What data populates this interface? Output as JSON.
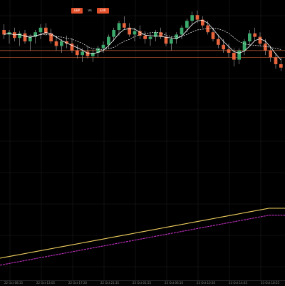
{
  "header": {
    "badge_left": "GBP",
    "badge_right": "EUR",
    "badge_separator": "vs"
  },
  "x_axis": {
    "ticks": [
      "22 Oct 08:15",
      "22 Oct 13:05",
      "22 Oct 17:20",
      "22 Oct 21:35",
      "23 Oct 01:55",
      "23 Oct 06:10",
      "23 Oct 10:30",
      "23 Oct 14:45",
      "23 Oct 18:55"
    ]
  },
  "colors": {
    "background": "#000000",
    "grid": "#1c1c1c",
    "bull": "#3aa96b",
    "bear": "#e8643c",
    "wick": "#9a9a9a",
    "ma_fast": "#ffffff",
    "ma_slow": "#ffffff",
    "level_line": "#b0552e",
    "lower_yellow": "#f0d060",
    "lower_magenta": "#c030c0"
  },
  "chart_data": [
    {
      "type": "candlestick",
      "title": "",
      "ylim": [
        0,
        100
      ],
      "candles": [
        {
          "o": 80,
          "h": 85,
          "l": 72,
          "c": 76
        },
        {
          "o": 76,
          "h": 80,
          "l": 68,
          "c": 78
        },
        {
          "o": 78,
          "h": 82,
          "l": 70,
          "c": 73
        },
        {
          "o": 73,
          "h": 79,
          "l": 66,
          "c": 77
        },
        {
          "o": 77,
          "h": 80,
          "l": 68,
          "c": 70
        },
        {
          "o": 70,
          "h": 76,
          "l": 62,
          "c": 74
        },
        {
          "o": 74,
          "h": 80,
          "l": 68,
          "c": 78
        },
        {
          "o": 78,
          "h": 85,
          "l": 72,
          "c": 82
        },
        {
          "o": 82,
          "h": 86,
          "l": 75,
          "c": 77
        },
        {
          "o": 77,
          "h": 81,
          "l": 68,
          "c": 70
        },
        {
          "o": 70,
          "h": 75,
          "l": 62,
          "c": 66
        },
        {
          "o": 66,
          "h": 72,
          "l": 60,
          "c": 70
        },
        {
          "o": 70,
          "h": 75,
          "l": 64,
          "c": 68
        },
        {
          "o": 68,
          "h": 73,
          "l": 60,
          "c": 62
        },
        {
          "o": 62,
          "h": 67,
          "l": 55,
          "c": 58
        },
        {
          "o": 58,
          "h": 64,
          "l": 52,
          "c": 61
        },
        {
          "o": 61,
          "h": 66,
          "l": 55,
          "c": 57
        },
        {
          "o": 57,
          "h": 63,
          "l": 52,
          "c": 60
        },
        {
          "o": 60,
          "h": 66,
          "l": 56,
          "c": 64
        },
        {
          "o": 64,
          "h": 70,
          "l": 60,
          "c": 67
        },
        {
          "o": 67,
          "h": 76,
          "l": 64,
          "c": 74
        },
        {
          "o": 74,
          "h": 82,
          "l": 70,
          "c": 80
        },
        {
          "o": 80,
          "h": 88,
          "l": 75,
          "c": 86
        },
        {
          "o": 86,
          "h": 92,
          "l": 80,
          "c": 82
        },
        {
          "o": 82,
          "h": 86,
          "l": 74,
          "c": 76
        },
        {
          "o": 76,
          "h": 82,
          "l": 70,
          "c": 79
        },
        {
          "o": 79,
          "h": 84,
          "l": 72,
          "c": 75
        },
        {
          "o": 75,
          "h": 79,
          "l": 68,
          "c": 72
        },
        {
          "o": 72,
          "h": 77,
          "l": 66,
          "c": 74
        },
        {
          "o": 74,
          "h": 80,
          "l": 70,
          "c": 78
        },
        {
          "o": 78,
          "h": 82,
          "l": 72,
          "c": 74
        },
        {
          "o": 74,
          "h": 78,
          "l": 66,
          "c": 68
        },
        {
          "o": 68,
          "h": 74,
          "l": 62,
          "c": 72
        },
        {
          "o": 72,
          "h": 78,
          "l": 68,
          "c": 76
        },
        {
          "o": 76,
          "h": 84,
          "l": 72,
          "c": 82
        },
        {
          "o": 82,
          "h": 90,
          "l": 78,
          "c": 88
        },
        {
          "o": 88,
          "h": 96,
          "l": 84,
          "c": 93
        },
        {
          "o": 93,
          "h": 97,
          "l": 86,
          "c": 89
        },
        {
          "o": 89,
          "h": 92,
          "l": 82,
          "c": 84
        },
        {
          "o": 84,
          "h": 88,
          "l": 76,
          "c": 78
        },
        {
          "o": 78,
          "h": 82,
          "l": 70,
          "c": 72
        },
        {
          "o": 72,
          "h": 76,
          "l": 64,
          "c": 67
        },
        {
          "o": 67,
          "h": 72,
          "l": 60,
          "c": 63
        },
        {
          "o": 63,
          "h": 68,
          "l": 56,
          "c": 60
        },
        {
          "o": 60,
          "h": 64,
          "l": 48,
          "c": 54
        },
        {
          "o": 54,
          "h": 64,
          "l": 50,
          "c": 62
        },
        {
          "o": 62,
          "h": 72,
          "l": 58,
          "c": 70
        },
        {
          "o": 70,
          "h": 80,
          "l": 66,
          "c": 77
        },
        {
          "o": 77,
          "h": 82,
          "l": 70,
          "c": 74
        },
        {
          "o": 74,
          "h": 78,
          "l": 66,
          "c": 68
        },
        {
          "o": 68,
          "h": 72,
          "l": 58,
          "c": 62
        },
        {
          "o": 62,
          "h": 66,
          "l": 52,
          "c": 56
        },
        {
          "o": 56,
          "h": 60,
          "l": 46,
          "c": 50
        },
        {
          "o": 50,
          "h": 56,
          "l": 44,
          "c": 47
        }
      ]
    },
    {
      "type": "line",
      "title": "",
      "ylim": [
        0,
        100
      ],
      "series": [
        {
          "values": [
            20,
            21,
            22,
            23,
            24,
            25,
            26,
            27,
            28,
            29,
            30,
            31,
            32,
            33,
            34,
            35,
            36,
            37,
            38,
            39,
            40,
            41,
            42,
            43,
            44,
            45,
            46,
            47,
            48,
            49,
            50,
            51,
            52,
            53,
            54,
            55,
            56,
            57,
            58,
            59,
            60,
            61,
            62,
            63,
            64,
            65,
            66,
            67,
            68,
            69,
            70,
            70,
            70,
            70
          ]
        },
        {
          "values": [
            13,
            14,
            15,
            16,
            17,
            18,
            19,
            20,
            21,
            22,
            23,
            24,
            25,
            26,
            27,
            28,
            29,
            30,
            31,
            32,
            33,
            34,
            35,
            36,
            37,
            38,
            39,
            40,
            41,
            42,
            43,
            44,
            45,
            46,
            47,
            48,
            49,
            50,
            51,
            52,
            53,
            54,
            55,
            56,
            57,
            58,
            59,
            60,
            61,
            62,
            63,
            63,
            63,
            63
          ]
        }
      ]
    }
  ]
}
